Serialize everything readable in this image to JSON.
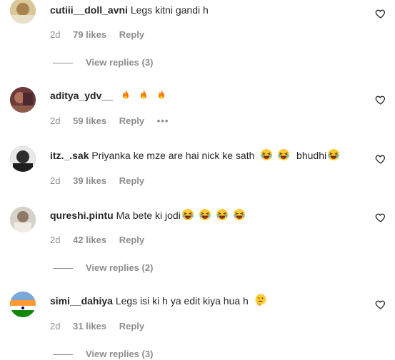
{
  "comments": [
    {
      "username": "cutiii__doll_avni",
      "text": "Legs kitni gandi h",
      "time": "2d",
      "likes": "79 likes",
      "reply_label": "Reply",
      "view_replies": "View replies (3)",
      "avatar_color": "#c9b07a"
    },
    {
      "username": "aditya_ydv__",
      "text": "",
      "emojis": [
        "fire",
        "fire",
        "fire"
      ],
      "time": "2d",
      "likes": "59 likes",
      "reply_label": "Reply",
      "more": "•••",
      "avatar_color": "#8a4a44"
    },
    {
      "username": "itz._.sak",
      "text": "Priyanka ke mze are hai nick ke sath",
      "text2": "bhudhi",
      "time": "2d",
      "likes": "39 likes",
      "reply_label": "Reply",
      "avatar_color": "#3a3a3a"
    },
    {
      "username": "qureshi.pintu",
      "text": "Ma bete ki jodi",
      "time": "2d",
      "likes": "42 likes",
      "reply_label": "Reply",
      "view_replies": "View replies (2)",
      "avatar_color": "#b8b0a2"
    },
    {
      "username": "simi__dahiya",
      "text": "Legs isi ki h ya edit kiya hua h",
      "time": "2d",
      "likes": "31 likes",
      "reply_label": "Reply",
      "view_replies": "View replies (3)",
      "avatar_color": "#3f7fbf"
    }
  ],
  "colors": {
    "primary_text": "#262626",
    "secondary_text": "#8e8e8e",
    "background": "#ffffff"
  },
  "icons": {
    "like": "heart-outline-icon",
    "fire": "fire-emoji",
    "laugh": "laughing-emoji",
    "think": "thinking-emoji"
  }
}
